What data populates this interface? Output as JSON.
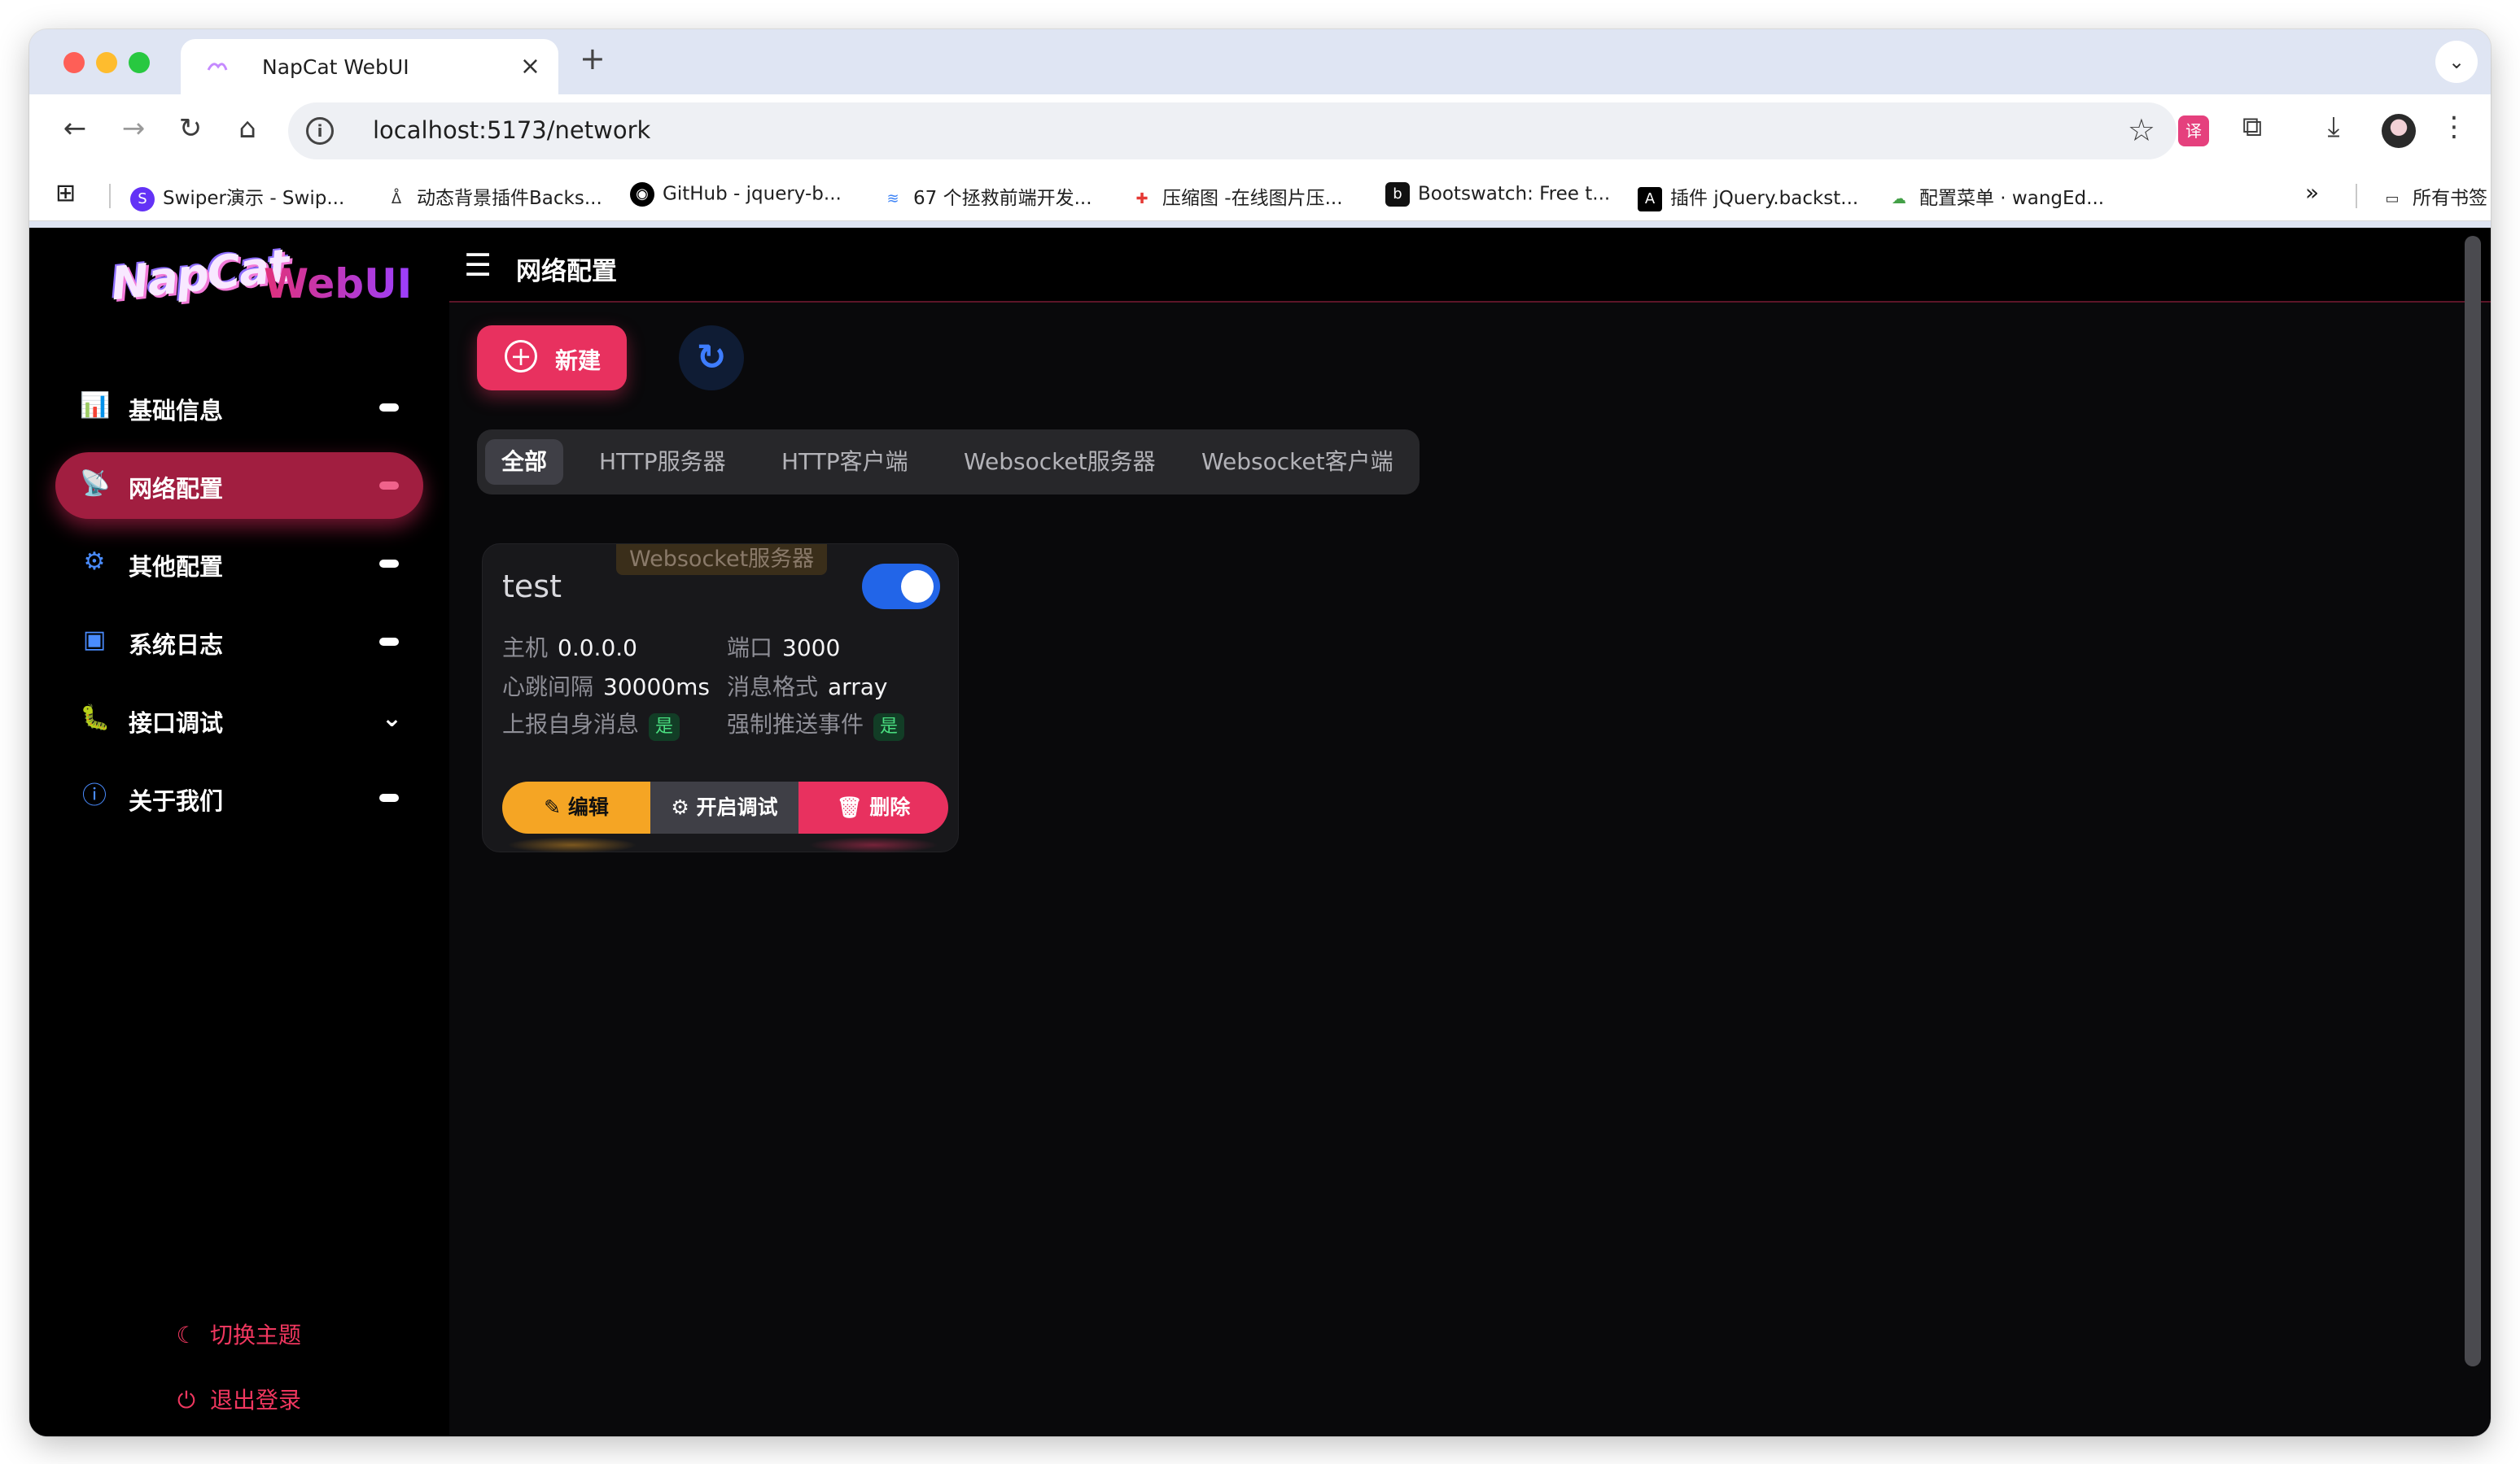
{
  "browser": {
    "tab_title": "NapCat WebUI",
    "new_tab": "+",
    "close": "×",
    "url": "localhost:5173/network",
    "bookmarks": [
      {
        "label": "Swiper演示 - Swip...",
        "icon": "swiper-icon",
        "color": "#6332f6"
      },
      {
        "label": "动态背景插件Backs...",
        "icon": "backstretch-icon",
        "color": "#333333"
      },
      {
        "label": "GitHub - jquery-b...",
        "icon": "github-icon",
        "color": "#000000"
      },
      {
        "label": "67 个拯救前端开发...",
        "icon": "layers-icon",
        "color": "#3b82f6"
      },
      {
        "label": "压缩图 -在线图片压...",
        "icon": "compress-icon",
        "color": "#e53935"
      },
      {
        "label": "Bootswatch: Free t...",
        "icon": "bootswatch-icon",
        "color": "#111111"
      },
      {
        "label": "插件 jQuery.backst...",
        "icon": "letter-a-icon",
        "color": "#000000"
      },
      {
        "label": "配置菜单 · wangEd...",
        "icon": "wangeditor-icon",
        "color": "#43a047"
      }
    ],
    "all_bookmarks": "所有书签"
  },
  "sidebar": {
    "logo_text": "NapCat",
    "logo_suffix": "WebUI",
    "items": [
      {
        "label": "基础信息",
        "icon": "dashboard-icon",
        "active": false,
        "trail": "dash"
      },
      {
        "label": "网络配置",
        "icon": "network-icon",
        "active": true,
        "trail": "dash"
      },
      {
        "label": "其他配置",
        "icon": "gear-icon",
        "active": false,
        "trail": "dash"
      },
      {
        "label": "系统日志",
        "icon": "terminal-icon",
        "active": false,
        "trail": "dash"
      },
      {
        "label": "接口调试",
        "icon": "bug-icon",
        "active": false,
        "trail": "chevron"
      },
      {
        "label": "关于我们",
        "icon": "info-icon",
        "active": false,
        "trail": "dash"
      }
    ],
    "theme_toggle": "切换主题",
    "logout": "退出登录"
  },
  "header": {
    "title": "网络配置"
  },
  "toolbar": {
    "new_label": "新建"
  },
  "filter_tabs": [
    "全部",
    "HTTP服务器",
    "HTTP客户端",
    "Websocket服务器",
    "Websocket客户端"
  ],
  "selected_tab": "全部",
  "card": {
    "name": "test",
    "type_chip": "Websocket服务器",
    "enabled": true,
    "host_label": "主机",
    "host": "0.0.0.0",
    "port_label": "端口",
    "port": "3000",
    "heartbeat_label": "心跳间隔",
    "heartbeat": "30000ms",
    "format_label": "消息格式",
    "format": "array",
    "report_self_label": "上报自身消息",
    "report_self": "是",
    "force_push_label": "强制推送事件",
    "force_push": "是",
    "edit_label": "编辑",
    "debug_label": "开启调试",
    "delete_label": "删除"
  },
  "colors": {
    "accent": "#e8315f",
    "active_nav": "#a11e40",
    "toggle": "#2265e8",
    "edit": "#f5a524"
  }
}
